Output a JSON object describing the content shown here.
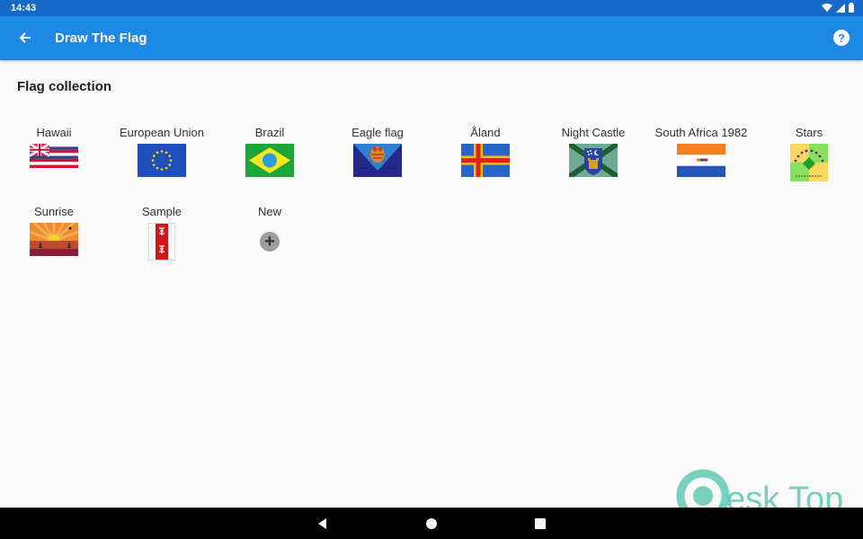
{
  "status_bar": {
    "time": "14:43",
    "icons": [
      "wifi-icon",
      "signal-icon",
      "battery-icon"
    ]
  },
  "app_bar": {
    "title": "Draw The Flag",
    "back_icon": "arrow-left-icon",
    "help_icon": "help-circle-icon",
    "help_glyph": "?",
    "color": "#1e88e5"
  },
  "section": {
    "title": "Flag collection"
  },
  "flags": [
    {
      "label": "Hawaii"
    },
    {
      "label": "European Union"
    },
    {
      "label": "Brazil"
    },
    {
      "label": "Eagle flag"
    },
    {
      "label": "Åland"
    },
    {
      "label": "Night Castle"
    },
    {
      "label": "South Africa 1982"
    },
    {
      "label": "Stars"
    },
    {
      "label": "Sunrise"
    },
    {
      "label": "Sample"
    }
  ],
  "new_tile": {
    "label": "New",
    "glyph": "+"
  },
  "nav_bar": {
    "buttons": [
      "back",
      "home",
      "recents"
    ]
  },
  "watermark": {
    "text": "esk Top"
  }
}
